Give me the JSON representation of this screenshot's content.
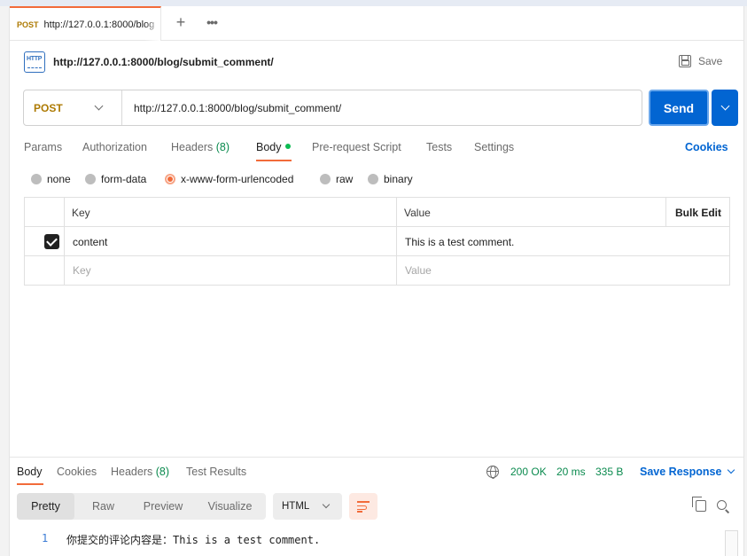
{
  "tab": {
    "method": "POST",
    "url": "http://127.0.0.1:8000/blog"
  },
  "icons": {
    "new_tab": "plus-icon",
    "more": "more-icon"
  },
  "request": {
    "title": "http://127.0.0.1:8000/blog/submit_comment/",
    "save_label": "Save",
    "method": "POST",
    "url": "http://127.0.0.1:8000/blog/submit_comment/",
    "send_label": "Send",
    "http_icon_text": "HTTP"
  },
  "request_tabs": {
    "params": "Params",
    "authorization": "Authorization",
    "headers": "Headers",
    "headers_count": "(8)",
    "body": "Body",
    "pre_request": "Pre-request Script",
    "tests": "Tests",
    "settings": "Settings",
    "cookies": "Cookies"
  },
  "body_types": {
    "none": "none",
    "form_data": "form-data",
    "urlencoded": "x-www-form-urlencoded",
    "raw": "raw",
    "binary": "binary",
    "selected": "x-www-form-urlencoded"
  },
  "kv_table": {
    "key_header": "Key",
    "value_header": "Value",
    "bulk_edit": "Bulk Edit",
    "rows": [
      {
        "checked": true,
        "key": "content",
        "value": "This is a test comment."
      }
    ],
    "key_placeholder": "Key",
    "value_placeholder": "Value"
  },
  "response": {
    "tabs": {
      "body": "Body",
      "cookies": "Cookies",
      "headers": "Headers",
      "headers_count": "(8)",
      "test_results": "Test Results"
    },
    "status": "200 OK",
    "time": "20 ms",
    "size": "335 B",
    "save_response": "Save Response",
    "views": {
      "pretty": "Pretty",
      "raw": "Raw",
      "preview": "Preview",
      "visualize": "Visualize",
      "active": "Pretty"
    },
    "format": "HTML",
    "line_number": "1",
    "line_text": "你提交的评论内容是：This is a test comment."
  },
  "colors": {
    "accent_orange": "#f26b3a",
    "send_blue": "#0265d2",
    "method_post": "#ad7a03",
    "status_green": "#0a8a4e"
  }
}
